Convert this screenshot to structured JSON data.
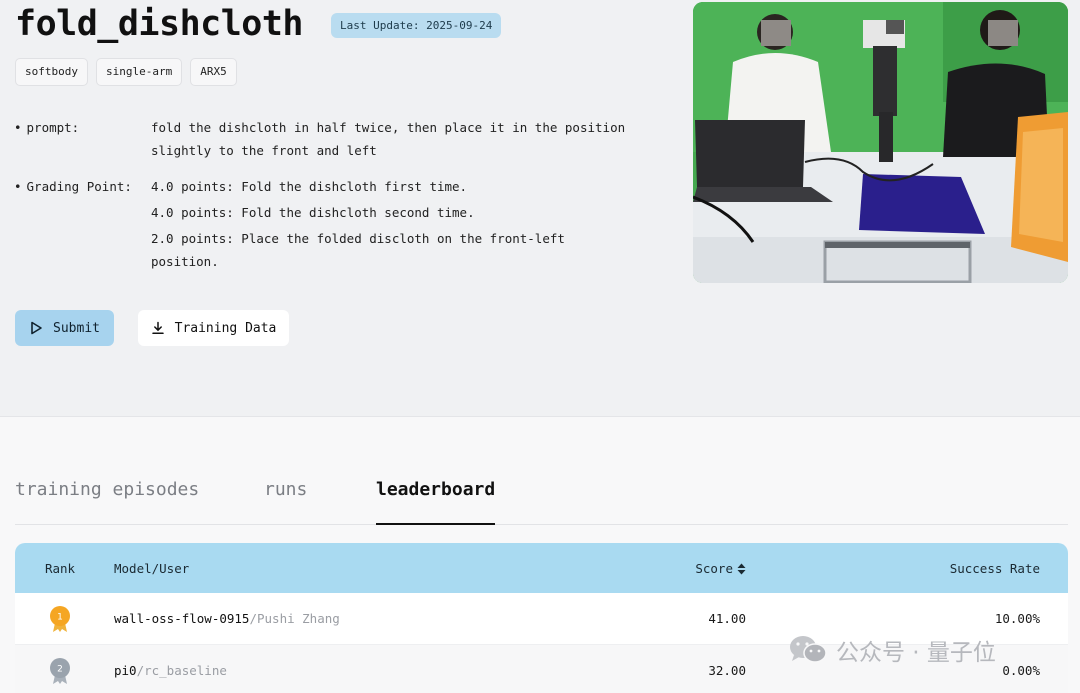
{
  "task": {
    "title": "fold_dishcloth",
    "last_update": "Last Update: 2025-09-24",
    "tags": [
      "softbody",
      "single-arm",
      "ARX5"
    ]
  },
  "fields": {
    "prompt_label": "prompt:",
    "prompt_line1": "fold the dishcloth in half twice, then place it in the position",
    "prompt_line2": "slightly to the front and left",
    "grading_label": "Grading Point:",
    "grading": [
      "4.0 points: Fold the dishcloth first time.",
      "4.0 points: Fold the dishcloth second time.",
      "2.0 points: Place the folded discloth on the front-left",
      "position."
    ]
  },
  "buttons": {
    "submit": "Submit",
    "training_data": "Training Data"
  },
  "tabs": [
    {
      "label": "training episodes",
      "active": false
    },
    {
      "label": "runs",
      "active": false
    },
    {
      "label": "leaderboard",
      "active": true
    }
  ],
  "leaderboard": {
    "headers": {
      "rank": "Rank",
      "model": "Model/User",
      "score": "Score",
      "success": "Success Rate"
    },
    "rows": [
      {
        "rank": "1",
        "model": "wall-oss-flow-0915",
        "user": "/Pushi Zhang",
        "score": "41.00",
        "success": "10.00%",
        "medal_color": "#f5a623"
      },
      {
        "rank": "2",
        "model": "pi0",
        "user": "/rc_baseline",
        "score": "32.00",
        "success": "0.00%",
        "medal_color": "#9aa3ad"
      }
    ]
  },
  "watermark": {
    "text": "公众号 · 量子位",
    "icon": "wechat-icon"
  },
  "colors": {
    "accent": "#a9daf1",
    "badge": "#b9dcf0",
    "gold": "#f5a623",
    "silver": "#9aa3ad"
  }
}
